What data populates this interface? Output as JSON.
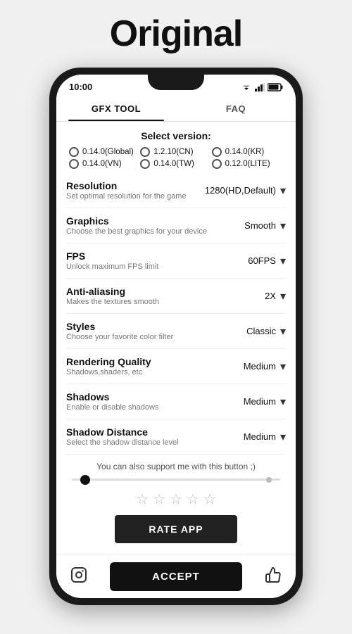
{
  "page": {
    "title": "Original"
  },
  "statusBar": {
    "time": "10:00",
    "icons": "▼▲■"
  },
  "tabs": [
    {
      "id": "gfx",
      "label": "GFX TOOL",
      "active": true
    },
    {
      "id": "faq",
      "label": "FAQ",
      "active": false
    }
  ],
  "selectVersion": {
    "title": "Select version:",
    "options": [
      {
        "id": "v1",
        "label": "0.14.0(Global)"
      },
      {
        "id": "v2",
        "label": "1.2.10(CN)"
      },
      {
        "id": "v3",
        "label": "0.14.0(KR)"
      },
      {
        "id": "v4",
        "label": "0.14.0(VN)"
      },
      {
        "id": "v5",
        "label": "0.14.0(TW)"
      },
      {
        "id": "v6",
        "label": "0.12.0(LITE)"
      }
    ]
  },
  "settings": [
    {
      "id": "resolution",
      "name": "Resolution",
      "desc": "Set optimal resolution for the game",
      "value": "1280(HD,Default)"
    },
    {
      "id": "graphics",
      "name": "Graphics",
      "desc": "Choose the best graphics for your device",
      "value": "Smooth"
    },
    {
      "id": "fps",
      "name": "FPS",
      "desc": "Unlock maximum FPS limit",
      "value": "60FPS"
    },
    {
      "id": "anti-aliasing",
      "name": "Anti-aliasing",
      "desc": "Makes the textures smooth",
      "value": "2X"
    },
    {
      "id": "styles",
      "name": "Styles",
      "desc": "Choose your favorite color filter",
      "value": "Classic"
    },
    {
      "id": "rendering-quality",
      "name": "Rendering Quality",
      "desc": "Shadows,shaders, etc",
      "value": "Medium"
    },
    {
      "id": "shadows",
      "name": "Shadows",
      "desc": "Enable or disable shadows",
      "value": "Medium"
    },
    {
      "id": "shadow-distance",
      "name": "Shadow Distance",
      "desc": "Select the shadow distance level",
      "value": "Medium"
    }
  ],
  "supportText": "You can also support me with this button ;)",
  "stars": [
    "☆",
    "☆",
    "☆",
    "☆",
    "☆"
  ],
  "rateBtn": "RATE APP",
  "acceptBtn": "ACCEPT",
  "chevron": "▾"
}
